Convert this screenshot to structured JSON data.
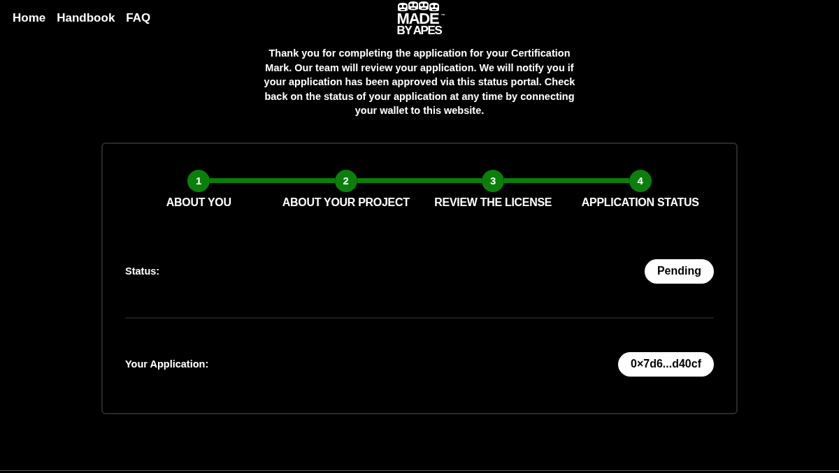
{
  "nav": [
    "Home",
    "Handbook",
    "FAQ"
  ],
  "logo": {
    "line_1": "MADE",
    "line_2": "BY APES",
    "mark": "™"
  },
  "intro": "Thank you for completing the application for your Certification Mark. Our team will review your application. We will notify you if your application has been approved via this status portal. Check back on the status of your application at any time by connecting your wallet to this website.",
  "steps": [
    {
      "number": "1",
      "label": "ABOUT YOU",
      "completed": true
    },
    {
      "number": "2",
      "label": "ABOUT YOUR PROJECT",
      "completed": true
    },
    {
      "number": "3",
      "label": "REVIEW THE LICENSE",
      "completed": true
    },
    {
      "number": "4",
      "label": "APPLICATION STATUS",
      "completed": true
    }
  ],
  "details": [
    {
      "label": "Status:",
      "value": "Pending"
    },
    {
      "label": "Your Application:",
      "value": "0×7d6...d40cf"
    }
  ]
}
